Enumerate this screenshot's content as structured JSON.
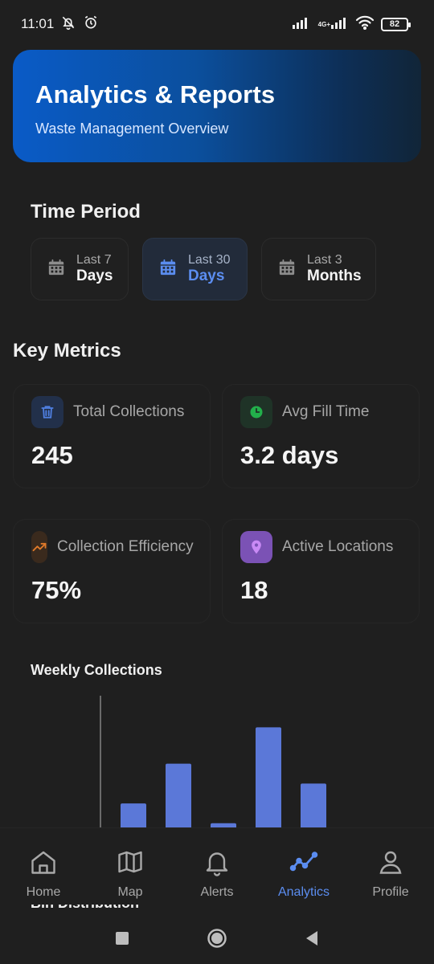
{
  "status_bar": {
    "time": "11:01",
    "network": "4G+",
    "battery": "82"
  },
  "header": {
    "title": "Analytics & Reports",
    "subtitle": "Waste Management Overview"
  },
  "time_period": {
    "title": "Time Period",
    "options": [
      {
        "top": "Last 7",
        "bottom": "Days",
        "active": false
      },
      {
        "top": "Last 30",
        "bottom": "Days",
        "active": true
      },
      {
        "top": "Last 3",
        "bottom": "Months",
        "active": false
      }
    ]
  },
  "key_metrics": {
    "title": "Key Metrics",
    "cards": [
      {
        "label": "Total Collections",
        "value": "245",
        "icon": "trash-icon",
        "color": "#4f7fe0"
      },
      {
        "label": "Avg Fill Time",
        "value": "3.2 days",
        "icon": "clock-icon",
        "color": "#22b04b"
      },
      {
        "label": "Collection Efficiency",
        "value": "75%",
        "icon": "trend-up-icon",
        "color": "#e07a2a"
      },
      {
        "label": "Active Locations",
        "value": "18",
        "icon": "location-pin-icon",
        "color": "#b36de8"
      }
    ]
  },
  "weekly_chart": {
    "title": "Weekly Collections"
  },
  "chart_data": {
    "type": "bar",
    "values": [
      32,
      56,
      20,
      78,
      44
    ],
    "ylim": [
      0,
      100
    ],
    "color": "#5b78d8"
  },
  "bin_distribution": {
    "title": "Bin Distribution"
  },
  "bottom_nav": {
    "items": [
      {
        "label": "Home",
        "icon": "home-icon",
        "active": false
      },
      {
        "label": "Map",
        "icon": "map-icon",
        "active": false
      },
      {
        "label": "Alerts",
        "icon": "bell-icon",
        "active": false
      },
      {
        "label": "Analytics",
        "icon": "analytics-icon",
        "active": true
      },
      {
        "label": "Profile",
        "icon": "profile-icon",
        "active": false
      }
    ]
  },
  "colors": {
    "accent": "#5b8df0",
    "background": "#1f1f1f"
  }
}
